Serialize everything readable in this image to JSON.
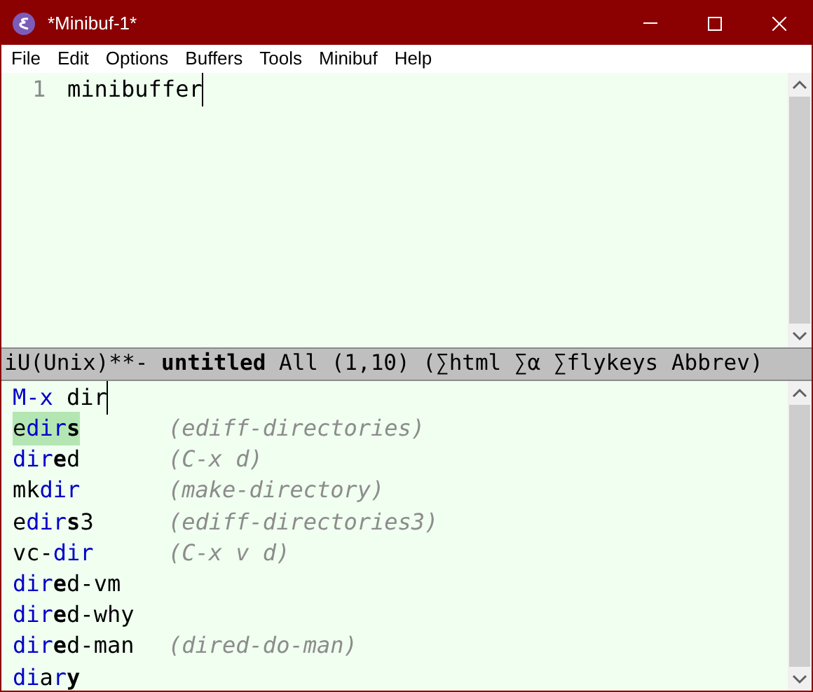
{
  "window": {
    "title": "*Minibuf-1*"
  },
  "menu": [
    "File",
    "Edit",
    "Options",
    "Buffers",
    "Tools",
    "Minibuf",
    "Help"
  ],
  "editor": {
    "lines": [
      {
        "number": "1",
        "text": "minibuffer"
      }
    ]
  },
  "mode_line": {
    "prefix": "iU(Unix)**-",
    "buffer_name": "untitled",
    "rest": "All (1,10) (∑html ∑α ∑flykeys Abbrev)"
  },
  "minibuffer": {
    "prompt": "M-x",
    "input": "dir",
    "candidates": [
      {
        "segments": [
          {
            "text": "e",
            "kind": "plain"
          },
          {
            "text": "dir",
            "kind": "match"
          },
          {
            "text": "s",
            "kind": "next"
          }
        ],
        "annotation": "(ediff-directories)",
        "selected": true
      },
      {
        "segments": [
          {
            "text": "dir",
            "kind": "match"
          },
          {
            "text": "e",
            "kind": "next"
          },
          {
            "text": "d",
            "kind": "plain"
          }
        ],
        "annotation": "(C-x d)",
        "selected": false
      },
      {
        "segments": [
          {
            "text": "mk",
            "kind": "plain"
          },
          {
            "text": "dir",
            "kind": "match"
          }
        ],
        "annotation": "(make-directory)",
        "selected": false
      },
      {
        "segments": [
          {
            "text": "e",
            "kind": "plain"
          },
          {
            "text": "dir",
            "kind": "match"
          },
          {
            "text": "s",
            "kind": "next"
          },
          {
            "text": "3",
            "kind": "plain"
          }
        ],
        "annotation": "(ediff-directories3)",
        "selected": false
      },
      {
        "segments": [
          {
            "text": "vc-",
            "kind": "plain"
          },
          {
            "text": "dir",
            "kind": "match"
          }
        ],
        "annotation": "(C-x v d)",
        "selected": false
      },
      {
        "segments": [
          {
            "text": "dir",
            "kind": "match"
          },
          {
            "text": "e",
            "kind": "next"
          },
          {
            "text": "d-vm",
            "kind": "plain"
          }
        ],
        "selected": false
      },
      {
        "segments": [
          {
            "text": "dir",
            "kind": "match"
          },
          {
            "text": "e",
            "kind": "next"
          },
          {
            "text": "d-why",
            "kind": "plain"
          }
        ],
        "selected": false
      },
      {
        "segments": [
          {
            "text": "dir",
            "kind": "match"
          },
          {
            "text": "e",
            "kind": "next"
          },
          {
            "text": "d-man",
            "kind": "plain"
          }
        ],
        "annotation": "(dired-do-man)",
        "selected": false
      },
      {
        "segments": [
          {
            "text": "di",
            "kind": "match"
          },
          {
            "text": "a",
            "kind": "plain"
          },
          {
            "text": "r",
            "kind": "match"
          },
          {
            "text": "y",
            "kind": "next"
          }
        ],
        "selected": false
      }
    ]
  }
}
